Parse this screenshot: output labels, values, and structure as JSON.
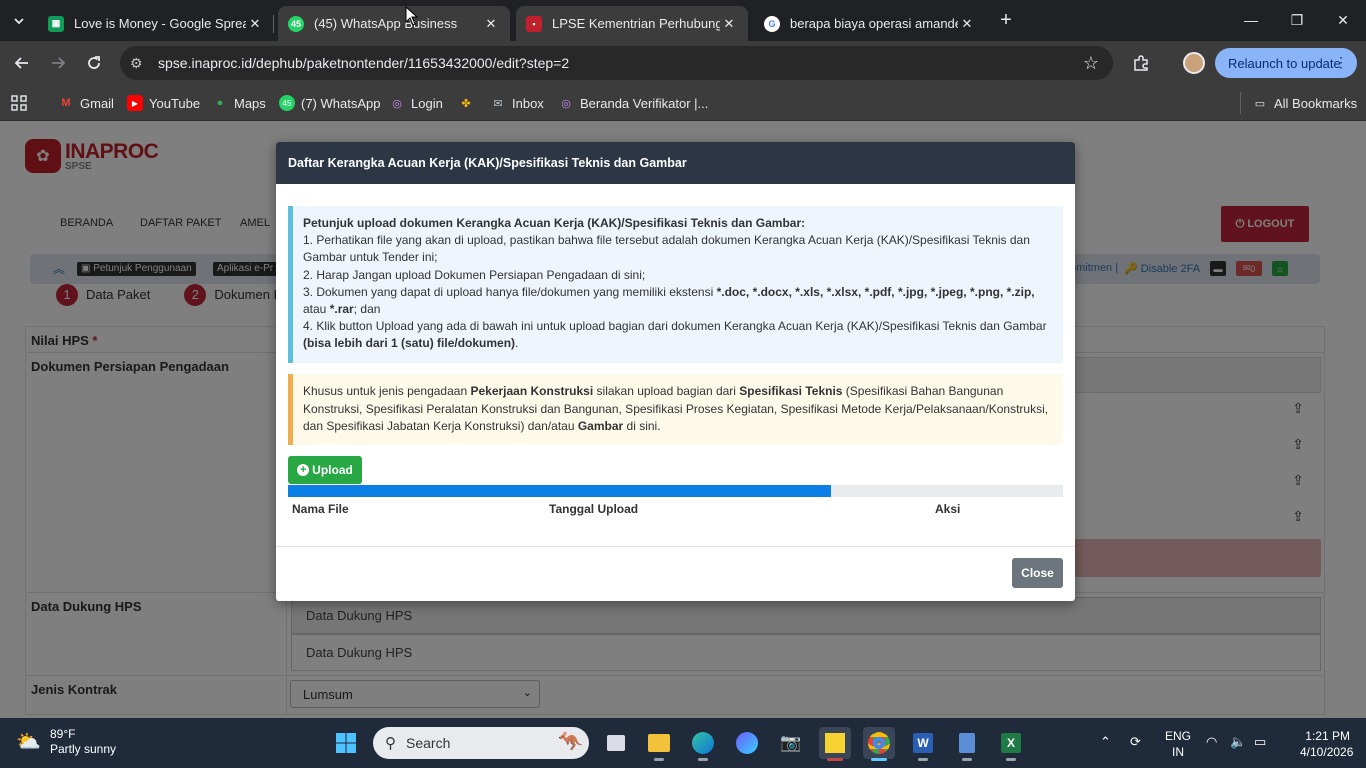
{
  "browser": {
    "tab_search_icon": "chevron-down",
    "tabs": [
      {
        "title": "Love is Money - Google Spreadsheet",
        "favicon": "sheets-icon",
        "color": "#0f9d58"
      },
      {
        "title": "(45) WhatsApp Business",
        "favicon": "whatsapp-icon",
        "color": "#25d366",
        "favicon_text": "45"
      },
      {
        "title": "LPSE Kementrian Perhubungan",
        "favicon": "lpse-icon",
        "color": "#c0202a"
      },
      {
        "title": "berapa biaya operasi amandel - Google Search",
        "favicon": "google-icon",
        "color": "#ffffff"
      }
    ],
    "new_tab": "+",
    "window": {
      "minimize": "—",
      "maximize": "❐",
      "close": "✕"
    },
    "url": "spse.inaproc.id/dephub/paketnontender/11653432000/edit?step=2",
    "relaunch_label": "Relaunch to update",
    "bookmarks": [
      {
        "label": "Gmail",
        "icon": "gmail-icon"
      },
      {
        "label": "YouTube",
        "icon": "youtube-icon"
      },
      {
        "label": "Maps",
        "icon": "maps-icon"
      },
      {
        "label": "(7) WhatsApp",
        "icon": "whatsapp-icon",
        "badge": "45"
      },
      {
        "label": "Login",
        "icon": "login-icon"
      },
      {
        "label": "",
        "icon": "pinwheel-icon"
      },
      {
        "label": "Inbox",
        "icon": "inbox-icon"
      },
      {
        "label": "Beranda Verifikator |...",
        "icon": "globe-icon"
      }
    ],
    "all_bookmarks": "All Bookmarks"
  },
  "site": {
    "logo_title": "INAPROC",
    "logo_sub": "SPSE",
    "nav": [
      "BERANDA",
      "DAFTAR PAKET",
      "AMEL"
    ],
    "logout": "LOGOUT",
    "subbar": {
      "guide": "Petunjuk Penggunaan",
      "app": "Aplikasi e-Pr",
      "commit": "omitmen |",
      "disable_2fa": "Disable 2FA",
      "mail_count": "0"
    },
    "steps": [
      {
        "num": "1",
        "label": "Data Paket"
      },
      {
        "num": "2",
        "label": "Dokumen P"
      }
    ],
    "fields": {
      "nilai_hps": "Nilai HPS",
      "required_mark": "*",
      "dokumen_persiapan": "Dokumen Persiapan Pengadaan",
      "data_dukung": "Data Dukung HPS",
      "data_dukung_header": "Data Dukung HPS",
      "data_dukung_row": "Data Dukung HPS",
      "jenis_kontrak": "Jenis Kontrak",
      "jenis_kontrak_value": "Lumsum"
    }
  },
  "modal": {
    "title": "Daftar Kerangka Acuan Kerja (KAK)/Spesifikasi Teknis dan Gambar",
    "info": {
      "heading": "Petunjuk upload dokumen Kerangka Acuan Kerja (KAK)/Spesifikasi Teknis dan Gambar:",
      "l1": "1. Perhatikan file yang akan di upload, pastikan bahwa file tersebut adalah dokumen Kerangka Acuan Kerja (KAK)/Spesifikasi Teknis dan Gambar untuk Tender ini;",
      "l2": "2. Harap Jangan upload Dokumen Persiapan Pengadaan di sini;",
      "l3a": "3. Dokumen yang dapat di upload hanya file/dokumen yang memiliki ekstensi ",
      "l3b": "*.doc, *.docx, *.xls, *.xlsx, *.pdf, *.jpg, *.jpeg, *.png, *.zip,",
      "l3c": " atau ",
      "l3d": "*.rar",
      "l3e": "; dan",
      "l4a": "4. Klik button Upload yang ada di bawah ini untuk upload bagian dari dokumen Kerangka Acuan Kerja (KAK)/Spesifikasi Teknis dan Gambar ",
      "l4b": "(bisa lebih dari 1 (satu) file/dokumen)",
      "l4c": "."
    },
    "warn": {
      "a": "Khusus untuk jenis pengadaan ",
      "b": "Pekerjaan Konstruksi",
      "c": " silakan upload bagian dari ",
      "d": "Spesifikasi Teknis",
      "e": " (Spesifikasi Bahan Bangunan Konstruksi, Spesifikasi Peralatan Konstruksi dan Bangunan, Spesifikasi Proses Kegiatan, Spesifikasi Metode Kerja/Pelaksanaan/Konstruksi, dan Spesifikasi Jabatan Kerja Konstruksi) dan/atau ",
      "f": "Gambar",
      "g": " di sini."
    },
    "upload_label": "Upload",
    "progress_percent": 70,
    "columns": [
      "Nama File",
      "Tanggal Upload",
      "Aksi"
    ],
    "close_label": "Close"
  },
  "taskbar": {
    "weather_temp": "89°F",
    "weather_desc": "Partly sunny",
    "search_placeholder": "Search",
    "lang1": "ENG",
    "lang2": "IN",
    "time": "1:21 PM",
    "date": "4/10/2026"
  }
}
